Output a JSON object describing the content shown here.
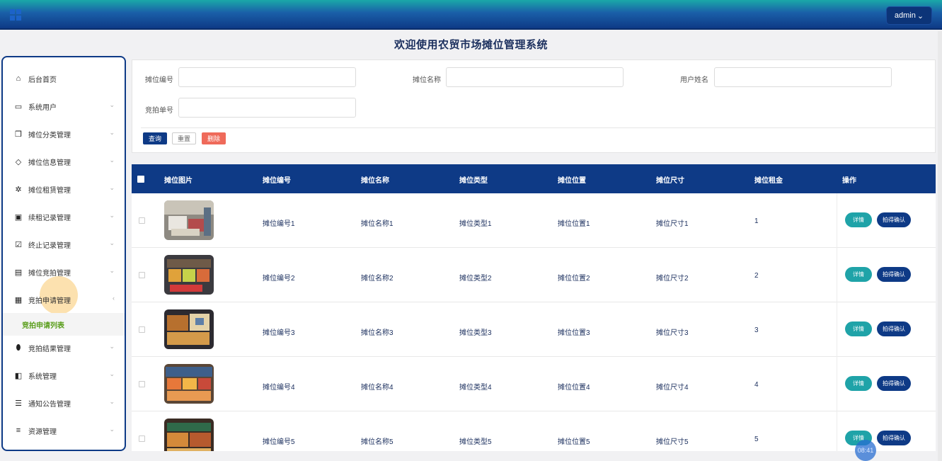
{
  "header": {
    "user_label": "admin"
  },
  "page_title": "欢迎使用农贸市场摊位管理系统",
  "sidebar": {
    "items": [
      {
        "label": "后台首页",
        "icon": "home-icon",
        "glyph": "⌂"
      },
      {
        "label": "系统用户",
        "icon": "laptop-icon",
        "glyph": "▭"
      },
      {
        "label": "摊位分类管理",
        "icon": "bookmark-icon",
        "glyph": "❒"
      },
      {
        "label": "摊位信息管理",
        "icon": "tag-icon",
        "glyph": "◇"
      },
      {
        "label": "摊位租赁管理",
        "icon": "sun-icon",
        "glyph": "✲"
      },
      {
        "label": "续租记录管理",
        "icon": "inbox-icon",
        "glyph": "▣"
      },
      {
        "label": "终止记录管理",
        "icon": "clipboard-check-icon",
        "glyph": "☑"
      },
      {
        "label": "摊位竞拍管理",
        "icon": "comment-icon",
        "glyph": "▤"
      },
      {
        "label": "竞拍申请管理",
        "icon": "archive-icon",
        "glyph": "▦"
      },
      {
        "label": "竞拍结果管理",
        "icon": "pill-icon",
        "glyph": "⬮"
      },
      {
        "label": "系统管理",
        "icon": "clone-icon",
        "glyph": "◧"
      },
      {
        "label": "通知公告管理",
        "icon": "sliders-icon",
        "glyph": "☰"
      },
      {
        "label": "资源管理",
        "icon": "list-icon",
        "glyph": "≡"
      }
    ],
    "active_sub_item": "竞拍申请列表"
  },
  "search": {
    "fields": [
      {
        "label": "摊位编号",
        "value": ""
      },
      {
        "label": "摊位名称",
        "value": ""
      },
      {
        "label": "用户姓名",
        "value": ""
      },
      {
        "label": "竞拍单号",
        "value": ""
      }
    ],
    "query_label": "查询",
    "reset_label": "重置",
    "delete_label": "删除"
  },
  "table": {
    "columns": [
      "摊位图片",
      "摊位编号",
      "摊位名称",
      "摊位类型",
      "摊位位置",
      "摊位尺寸",
      "摊位租金",
      "操作"
    ],
    "rows": [
      {
        "code": "摊位编号1",
        "name": "摊位名称1",
        "type": "摊位类型1",
        "location": "摊位位置1",
        "size": "摊位尺寸1",
        "rent": "1"
      },
      {
        "code": "摊位编号2",
        "name": "摊位名称2",
        "type": "摊位类型2",
        "location": "摊位位置2",
        "size": "摊位尺寸2",
        "rent": "2"
      },
      {
        "code": "摊位编号3",
        "name": "摊位名称3",
        "type": "摊位类型3",
        "location": "摊位位置3",
        "size": "摊位尺寸3",
        "rent": "3"
      },
      {
        "code": "摊位编号4",
        "name": "摊位名称4",
        "type": "摊位类型4",
        "location": "摊位位置4",
        "size": "摊位尺寸4",
        "rent": "4"
      },
      {
        "code": "摊位编号5",
        "name": "摊位名称5",
        "type": "摊位类型5",
        "location": "摊位位置5",
        "size": "摊位尺寸5",
        "rent": "5"
      }
    ],
    "detail_label": "详情",
    "confirm_label": "拍得确认"
  },
  "timer": "08:41",
  "colors": {
    "primary": "#0e3a86",
    "accent_teal": "#1fa3a8",
    "danger": "#ef6a5a",
    "active_sub": "#5a9e1c"
  }
}
